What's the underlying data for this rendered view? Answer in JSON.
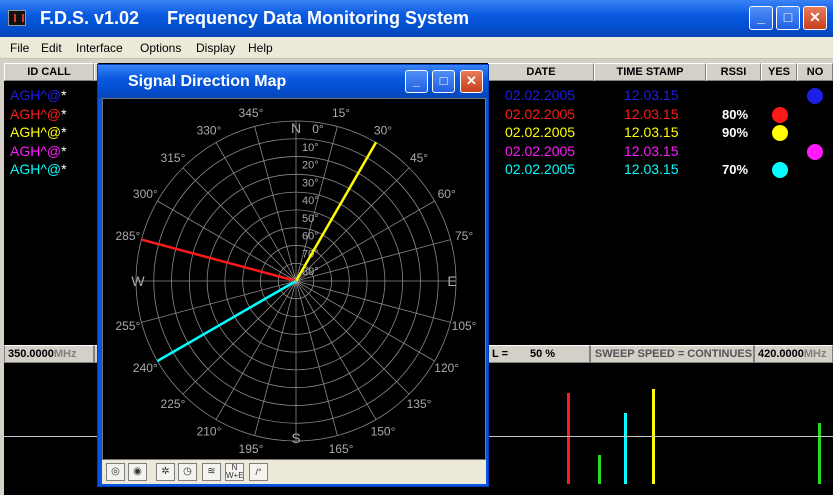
{
  "window": {
    "app_name": "F.D.S. v1.02",
    "title": "Frequency Data Monitoring System",
    "minimize": "_",
    "maximize": "□",
    "close": "✕"
  },
  "menu": [
    "File",
    "Edit",
    "Interface",
    "Options",
    "Display",
    "Help"
  ],
  "table": {
    "headers": {
      "id_call": "ID CALL",
      "date": "DATE",
      "time_stamp": "TIME STAMP",
      "rssi": "RSSI",
      "yes": "YES",
      "no": "NO"
    },
    "rows": [
      {
        "id": "AGH^@*",
        "date": "02.02.2005",
        "time": "12.03.15",
        "rssi": "",
        "color": "#1e1ee6",
        "dot": "no"
      },
      {
        "id": "AGH^@*",
        "date": "02.02.2005",
        "time": "12.03.15",
        "rssi": "80%",
        "color": "#ff1a1a",
        "dot": "yes"
      },
      {
        "id": "AGH^@*",
        "date": "02.02.2005",
        "time": "12.03.15",
        "rssi": "90%",
        "color": "#ffff00",
        "dot": "yes"
      },
      {
        "id": "AGH^@*",
        "date": "02.02.2005",
        "time": "12.03.15",
        "rssi": "",
        "color": "#ff1aff",
        "dot": "no"
      },
      {
        "id": "AGH^@*",
        "date": "02.02.2005",
        "time": "12.03.15",
        "rssi": "70%",
        "color": "#00ffff",
        "dot": "yes"
      }
    ]
  },
  "status_bar": {
    "freq_start": "350.0000",
    "freq_unit": "MHz",
    "level_label": "L =",
    "level_value": "50 %",
    "sweep": "SWEEP SPEED = CONTINUES",
    "freq_end": "420.0000"
  },
  "spectrum": {
    "bars": [
      {
        "level": 0.91,
        "color": "#ff1a1a"
      },
      {
        "level": 0.29,
        "color": "#22dd22"
      },
      {
        "level": 0.71,
        "color": "#00ffff"
      },
      {
        "level": 0.95,
        "color": "#ffff00"
      },
      {
        "level": 0.61,
        "color": "#22dd22"
      }
    ],
    "baseline_color": "#c8c8c8"
  },
  "popup": {
    "title": "Signal Direction Map",
    "minimize": "_",
    "maximize": "□",
    "close": "✕",
    "bearings": [
      {
        "angle": 30,
        "color": "#ffff00"
      },
      {
        "angle": 285,
        "color": "#ff1a1a"
      },
      {
        "angle": 240,
        "color": "#00ffff"
      }
    ],
    "compass": {
      "N": "N",
      "E": "E",
      "S": "S",
      "W": "W"
    },
    "angle_labels": [
      "0°",
      "15°",
      "30°",
      "45°",
      "60°",
      "75°",
      "105°",
      "120°",
      "135°",
      "150°",
      "165°",
      "195°",
      "210°",
      "225°",
      "240°",
      "255°",
      "285°",
      "300°",
      "315°",
      "330°",
      "345°"
    ],
    "ring_labels": [
      "10°",
      "20°",
      "30°",
      "40°",
      "50°",
      "60°",
      "70°",
      "80°"
    ],
    "toolbar": [
      "target-icon",
      "radar-icon",
      "compass-icon",
      "clock-icon",
      "signal-icon",
      "nwse-icon",
      "degree-icon"
    ]
  }
}
